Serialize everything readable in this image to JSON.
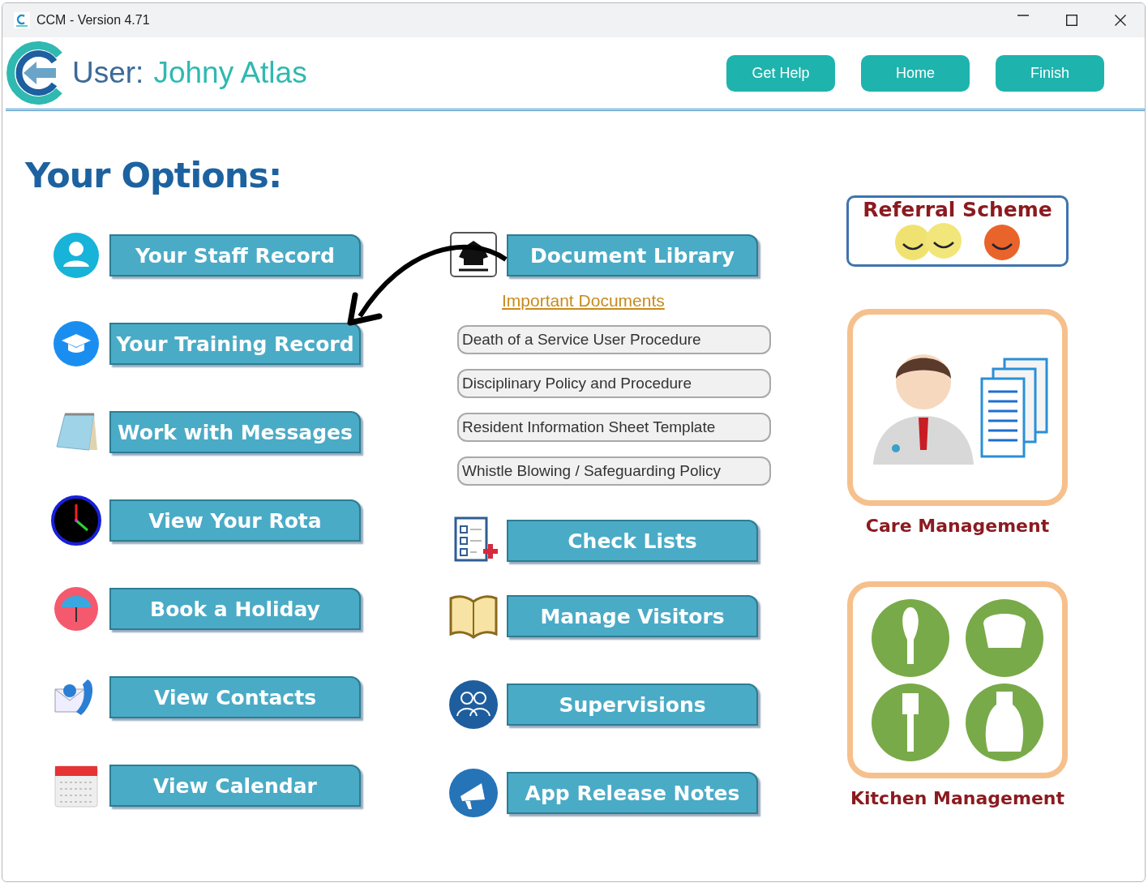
{
  "window": {
    "title": "CCM - Version 4.71"
  },
  "header": {
    "user_label": "User:",
    "user_name": "Johny Atlas",
    "buttons": [
      "Get Help",
      "Home",
      "Finish"
    ]
  },
  "heading": "Your Options:",
  "left_options": [
    {
      "label": "Your Staff Record",
      "kind": "person"
    },
    {
      "label": "Your Training Record",
      "kind": "graduation"
    },
    {
      "label": "Work with Messages",
      "kind": "notepad"
    },
    {
      "label": "View Your Rota",
      "kind": "clock"
    },
    {
      "label": "Book a Holiday",
      "kind": "umbrella"
    },
    {
      "label": "View Contacts",
      "kind": "contacts"
    },
    {
      "label": "View Calendar",
      "kind": "calendar"
    }
  ],
  "document_library": {
    "label": "Document Library",
    "link": "Important Documents",
    "documents": [
      "Death of a Service User Procedure",
      "Disciplinary Policy and Procedure",
      "Resident Information Sheet Template",
      "Whistle Blowing / Safeguarding Policy"
    ]
  },
  "middle_options": [
    {
      "label": "Check Lists",
      "kind": "checklist"
    },
    {
      "label": "Manage Visitors",
      "kind": "book"
    },
    {
      "label": "Supervisions",
      "kind": "people"
    },
    {
      "label": "App Release Notes",
      "kind": "megaphone"
    }
  ],
  "referral_scheme": {
    "title": "Referral Scheme"
  },
  "care_management": {
    "label": "Care Management"
  },
  "kitchen_management": {
    "label": "Kitchen Management"
  }
}
